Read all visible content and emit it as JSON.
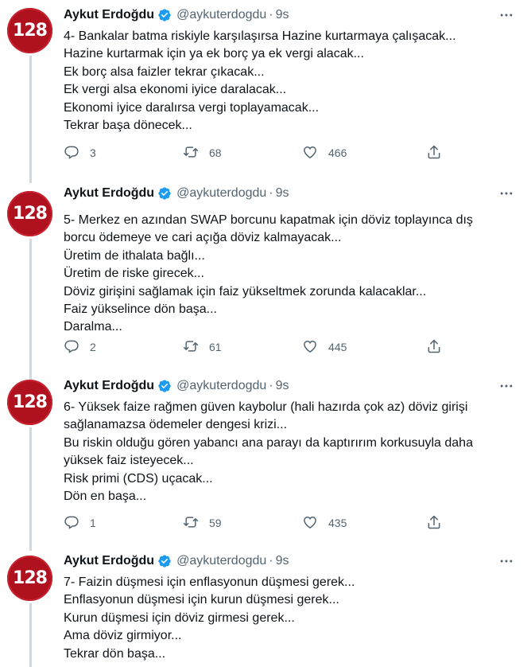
{
  "colors": {
    "avatar_bg": "#b0111f",
    "verified": "#1d9bf0",
    "muted": "#536471",
    "thread_line": "#cfd9de"
  },
  "tweets": [
    {
      "avatar_text": "128",
      "name": "Aykut Erdoğdu",
      "handle": "@aykuterdogdu",
      "separator": "·",
      "time": "9s",
      "lines": [
        "4- Bankalar batma riskiyle karşılaşırsa Hazine kurtarmaya çalışacak...",
        "Hazine kurtarmak için ya ek borç ya ek vergi alacak...",
        "Ek borç alsa faizler tekrar çıkacak...",
        "Ek vergi alsa ekonomi iyice daralacak...",
        "Ekonomi iyice daralırsa vergi toplayamacak...",
        "Tekrar başa dönecek..."
      ],
      "replies": "3",
      "retweets": "68",
      "likes": "466"
    },
    {
      "avatar_text": "128",
      "name": "Aykut Erdoğdu",
      "handle": "@aykuterdogdu",
      "separator": "·",
      "time": "9s",
      "lines": [
        "5- Merkez en azından SWAP borcunu kapatmak için döviz toplayınca dış",
        "borcu ödemeye ve cari açığa döviz kalmayacak...",
        "Üretim de ithalata bağlı...",
        "Üretim de riske girecek...",
        "Döviz girişini sağlamak için faiz yükseltmek zorunda kalacaklar...",
        "Faiz yükselince dön başa...",
        "Daralma..."
      ],
      "replies": "2",
      "retweets": "61",
      "likes": "445"
    },
    {
      "avatar_text": "128",
      "name": "Aykut Erdoğdu",
      "handle": "@aykuterdogdu",
      "separator": "·",
      "time": "9s",
      "lines": [
        "6- Yüksek faize rağmen güven kaybolur (hali hazırda çok az) döviz girişi",
        "sağlanamazsa ödemeler dengesi krizi...",
        "Bu riskin olduğu gören yabancı ana parayı da kaptırırım korkusuyla daha",
        "yüksek faiz isteyecek...",
        "Risk primi (CDS) uçacak...",
        "Dön en başa..."
      ],
      "replies": "1",
      "retweets": "59",
      "likes": "435"
    },
    {
      "avatar_text": "128",
      "name": "Aykut Erdoğdu",
      "handle": "@aykuterdogdu",
      "separator": "·",
      "time": "9s",
      "lines": [
        "7- Faizin düşmesi için enflasyonun düşmesi gerek...",
        "Enflasyonun düşmesi için kurun düşmesi gerek...",
        "Kurun düşmesi için döviz girmesi gerek...",
        "Ama döviz girmiyor...",
        "Tekrar dön başa..."
      ]
    }
  ],
  "icons": {
    "reply": "reply-icon",
    "retweet": "retweet-icon",
    "like": "heart-icon",
    "share": "share-icon",
    "more": "more-icon",
    "verified": "verified-badge-icon"
  }
}
